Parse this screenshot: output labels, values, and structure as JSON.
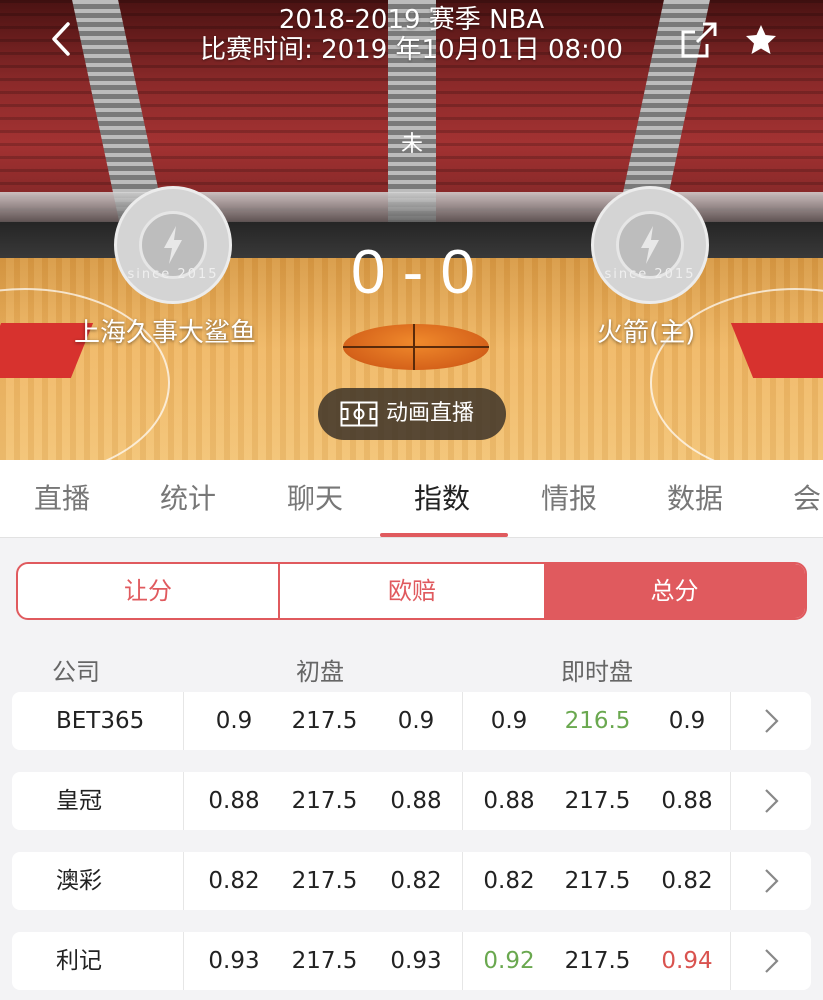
{
  "header": {
    "season": "2018-2019 赛季 NBA",
    "match_time": "比赛时间: 2019 年10月01日 08:00",
    "status": "未",
    "score": "0 - 0",
    "home_team": "上海久事大鲨鱼",
    "away_team": "火箭(主)",
    "logo_text": "since 2015",
    "animation_label": "动画直播"
  },
  "tabs": [
    {
      "label": "直播"
    },
    {
      "label": "统计"
    },
    {
      "label": "聊天"
    },
    {
      "label": "指数",
      "active": true
    },
    {
      "label": "情报"
    },
    {
      "label": "数据"
    },
    {
      "label": "会"
    }
  ],
  "segments": [
    {
      "label": "让分"
    },
    {
      "label": "欧赔"
    },
    {
      "label": "总分",
      "active": true
    }
  ],
  "columns": {
    "company": "公司",
    "initial": "初盘",
    "live": "即时盘"
  },
  "rows": [
    {
      "company": "BET365",
      "init": [
        "0.9",
        "217.5",
        "0.9"
      ],
      "live": [
        "0.9",
        "216.5",
        "0.9"
      ],
      "live_colors": [
        "",
        "green",
        ""
      ]
    },
    {
      "company": "皇冠",
      "init": [
        "0.88",
        "217.5",
        "0.88"
      ],
      "live": [
        "0.88",
        "217.5",
        "0.88"
      ],
      "live_colors": [
        "",
        "",
        ""
      ]
    },
    {
      "company": "澳彩",
      "init": [
        "0.82",
        "217.5",
        "0.82"
      ],
      "live": [
        "0.82",
        "217.5",
        "0.82"
      ],
      "live_colors": [
        "",
        "",
        ""
      ]
    },
    {
      "company": "利记",
      "init": [
        "0.93",
        "217.5",
        "0.93"
      ],
      "live": [
        "0.92",
        "217.5",
        "0.94"
      ],
      "live_colors": [
        "green",
        "",
        "red"
      ]
    }
  ],
  "colors": {
    "accent": "#e05a5e",
    "up": "#d9534f",
    "down": "#6aa84f"
  },
  "icons": {
    "back": "chevron-left-icon",
    "share": "share-icon",
    "favorite": "star-icon",
    "animation": "court-icon",
    "row_arrow": "chevron-right-icon"
  }
}
